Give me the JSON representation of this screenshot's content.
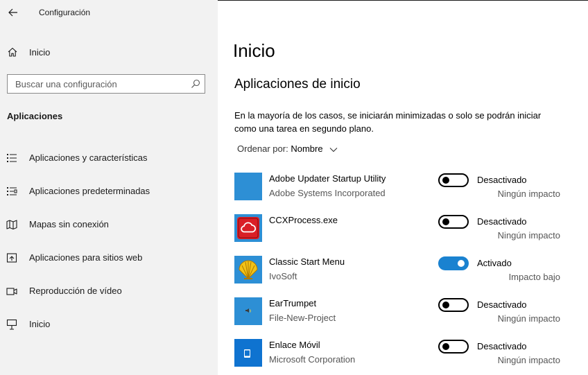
{
  "window": {
    "title": "Configuración"
  },
  "sidebar": {
    "home_label": "Inicio",
    "search_placeholder": "Buscar una configuración",
    "section_label": "Aplicaciones",
    "items": [
      {
        "label": "Aplicaciones y características",
        "icon": "apps-features-icon"
      },
      {
        "label": "Aplicaciones predeterminadas",
        "icon": "default-apps-icon"
      },
      {
        "label": "Mapas sin conexión",
        "icon": "offline-maps-icon"
      },
      {
        "label": "Aplicaciones para sitios web",
        "icon": "apps-for-websites-icon"
      },
      {
        "label": "Reproducción de vídeo",
        "icon": "video-playback-icon"
      },
      {
        "label": "Inicio",
        "icon": "startup-icon"
      }
    ]
  },
  "main": {
    "page_title": "Inicio",
    "section_title": "Aplicaciones de inicio",
    "description": "En la mayoría de los casos, se iniciarán minimizadas o solo se podrán iniciar como una tarea en segundo plano.",
    "sort_label": "Ordenar por:",
    "sort_value": "Nombre",
    "apps": [
      {
        "name": "Adobe Updater Startup Utility",
        "publisher": "Adobe Systems Incorporated",
        "enabled": false,
        "state": "Desactivado",
        "impact": "Ningún impacto",
        "icon": "adobe-updater-icon"
      },
      {
        "name": "CCXProcess.exe",
        "publisher": "",
        "enabled": false,
        "state": "Desactivado",
        "impact": "Ningún impacto",
        "icon": "creative-cloud-icon"
      },
      {
        "name": "Classic Start Menu",
        "publisher": "IvoSoft",
        "enabled": true,
        "state": "Activado",
        "impact": "Impacto bajo",
        "icon": "classic-shell-icon"
      },
      {
        "name": "EarTrumpet",
        "publisher": "File-New-Project",
        "enabled": false,
        "state": "Desactivado",
        "impact": "Ningún impacto",
        "icon": "eartrumpet-icon"
      },
      {
        "name": "Enlace Móvil",
        "publisher": "Microsoft Corporation",
        "enabled": false,
        "state": "Desactivado",
        "impact": "Ningún impacto",
        "icon": "your-phone-icon"
      }
    ]
  },
  "colors": {
    "sidebar_bg": "#f2f2f2",
    "accent": "#1a82d0",
    "app_tile": "#2d8fd5",
    "adobe_red": "#da1f26"
  }
}
